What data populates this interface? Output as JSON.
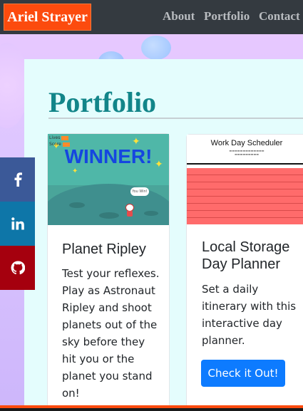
{
  "navbar": {
    "brand": "Ariel Strayer",
    "links": [
      "About",
      "Portfolio",
      "Contact"
    ]
  },
  "page": {
    "title": "Portfolio"
  },
  "cards": [
    {
      "title": "Planet Ripley",
      "text_lines": [
        "Test your reflexes.",
        "Play as Astronaut",
        "Ripley and shoot",
        "planets out of the",
        "sky before they",
        "hit you or the",
        "planet you stand",
        "on!"
      ],
      "thumb": {
        "banner": "WINNER!",
        "hud_lives": "Lives",
        "hud_score": "Score",
        "bubble": "You Win!"
      }
    },
    {
      "title_lines": [
        "Local Storage",
        "Day Planner"
      ],
      "text_lines": [
        "Set a daily",
        "itinerary with this",
        "interactive day",
        "planner."
      ],
      "button": "Check it Out!",
      "thumb": {
        "heading": "Work Day Scheduler"
      }
    }
  ],
  "social": {
    "icons": [
      "facebook-icon",
      "linkedin-icon",
      "github-icon"
    ],
    "colors": {
      "facebook": "#3b5998",
      "linkedin": "#0e76a8",
      "github": "#a5000e"
    }
  },
  "colors": {
    "brand": "#fc4b0e",
    "navbar": "#343a40",
    "title": "#128589",
    "button": "#0d7bff"
  }
}
